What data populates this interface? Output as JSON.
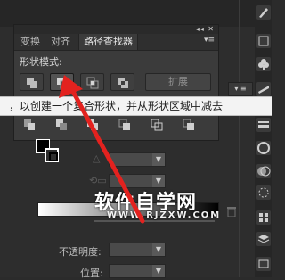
{
  "panel": {
    "tabs": [
      {
        "label": "变换",
        "active": false
      },
      {
        "label": "对齐",
        "active": false
      },
      {
        "label": "路径查找器",
        "active": true
      }
    ],
    "shape_modes_label": "形状模式:",
    "expand_label": "扩展",
    "shape_mode_buttons": [
      {
        "icon": "unite-icon",
        "selected": false
      },
      {
        "icon": "minus-front-icon",
        "selected": true
      },
      {
        "icon": "intersect-icon",
        "selected": false
      },
      {
        "icon": "exclude-icon",
        "selected": false
      }
    ],
    "pathfinder_buttons": [
      "divide-icon",
      "trim-icon",
      "merge-icon",
      "crop-icon",
      "outline-icon",
      "minus-back-icon"
    ]
  },
  "tooltip": {
    "text": "，以创建一个复合形状，并从形状区域中减去"
  },
  "properties": {
    "opacity_label": "不透明度:",
    "position_label": "位置:"
  },
  "watermark": {
    "title": "软件自学网",
    "url": "WWW.RJZXW.COM"
  },
  "colors": {
    "arrow": "#e3221f",
    "panel_bg": "#3b3b3b",
    "tooltip_bg": "#f3f3f3"
  }
}
